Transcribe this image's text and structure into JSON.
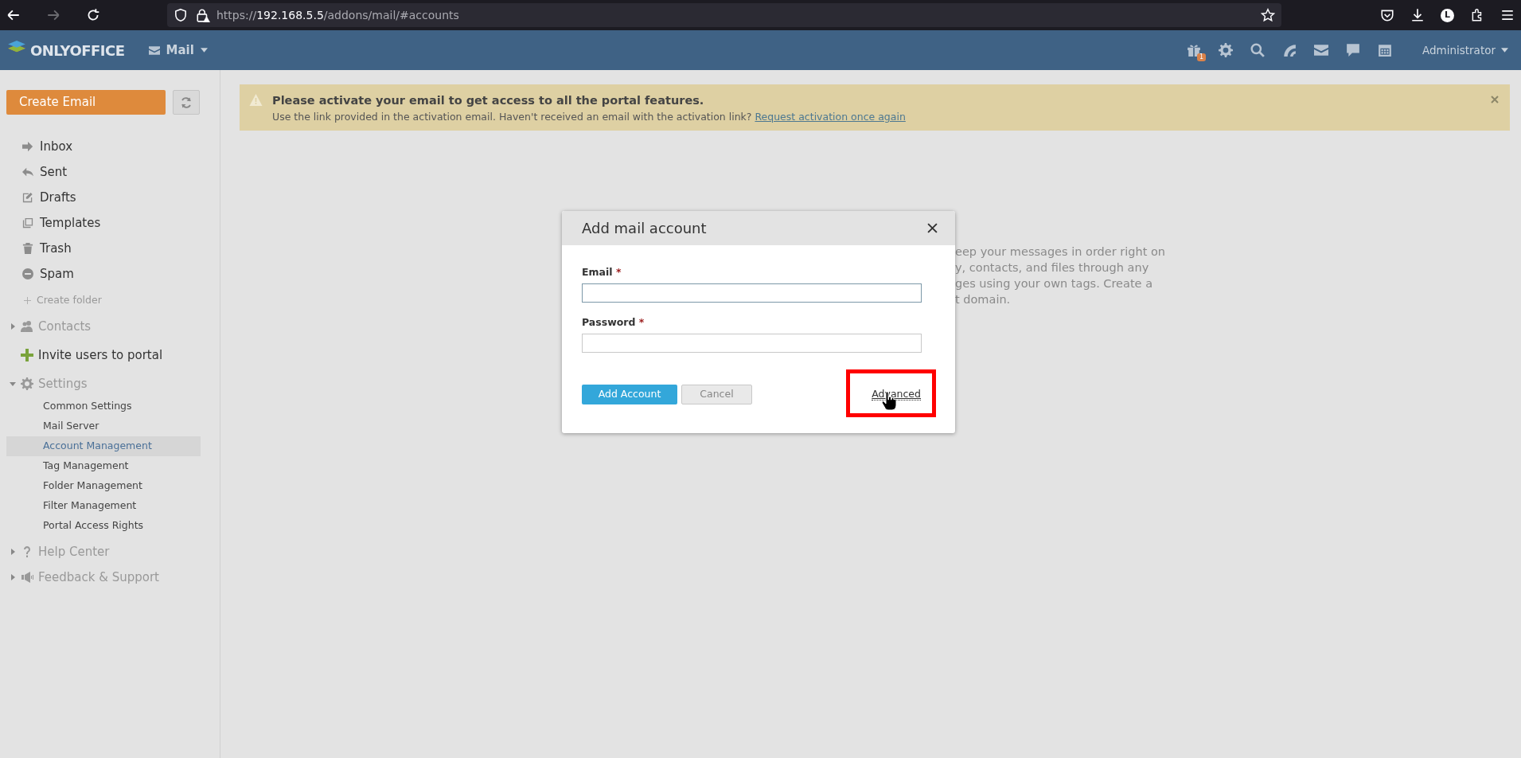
{
  "browser": {
    "back_disabled": false,
    "forward_disabled": true,
    "url_scheme": "https://",
    "url_host": "192.168.5.5",
    "url_path": "/addons/mail/#accounts",
    "profile_initial": "L"
  },
  "header": {
    "logo": "ONLYOFFICE",
    "module": "Mail",
    "gift_badge": "1",
    "user": "Administrator"
  },
  "sidebar": {
    "create_button": "Create Email",
    "folders": [
      {
        "label": "Inbox"
      },
      {
        "label": "Sent"
      },
      {
        "label": "Drafts"
      },
      {
        "label": "Templates"
      },
      {
        "label": "Trash"
      },
      {
        "label": "Spam"
      }
    ],
    "create_folder": "Create folder",
    "sections": [
      {
        "label": "Contacts",
        "kind": "group",
        "expanded": false
      },
      {
        "label": "Invite users to portal",
        "kind": "action"
      },
      {
        "label": "Settings",
        "kind": "group",
        "expanded": true,
        "children": [
          {
            "label": "Common Settings",
            "selected": false
          },
          {
            "label": "Mail Server",
            "selected": false
          },
          {
            "label": "Account Management",
            "selected": true
          },
          {
            "label": "Tag Management",
            "selected": false
          },
          {
            "label": "Folder Management",
            "selected": false
          },
          {
            "label": "Filter Management",
            "selected": false
          },
          {
            "label": "Portal Access Rights",
            "selected": false
          }
        ]
      },
      {
        "label": "Help Center",
        "kind": "group",
        "expanded": false
      },
      {
        "label": "Feedback & Support",
        "kind": "group",
        "expanded": false
      }
    ]
  },
  "banner": {
    "title": "Please activate your email to get access to all the portal features.",
    "message": "Use the link provided in the activation email. Haven't received an email with the activation link?",
    "link": "Request activation once again"
  },
  "background_text": [
    "eep your messages in order right on",
    "y, contacts, and files through any",
    "ges using your own tags. Create a",
    "t domain."
  ],
  "dialog": {
    "title": "Add mail account",
    "fields": [
      {
        "label": "Email",
        "required_mark": "*",
        "focused": true
      },
      {
        "label": "Password",
        "required_mark": "*",
        "focused": false
      }
    ],
    "primary_button": "Add Account",
    "cancel_button": "Cancel",
    "advanced_link": {
      "label": "Advanced",
      "highlighted": true
    }
  }
}
